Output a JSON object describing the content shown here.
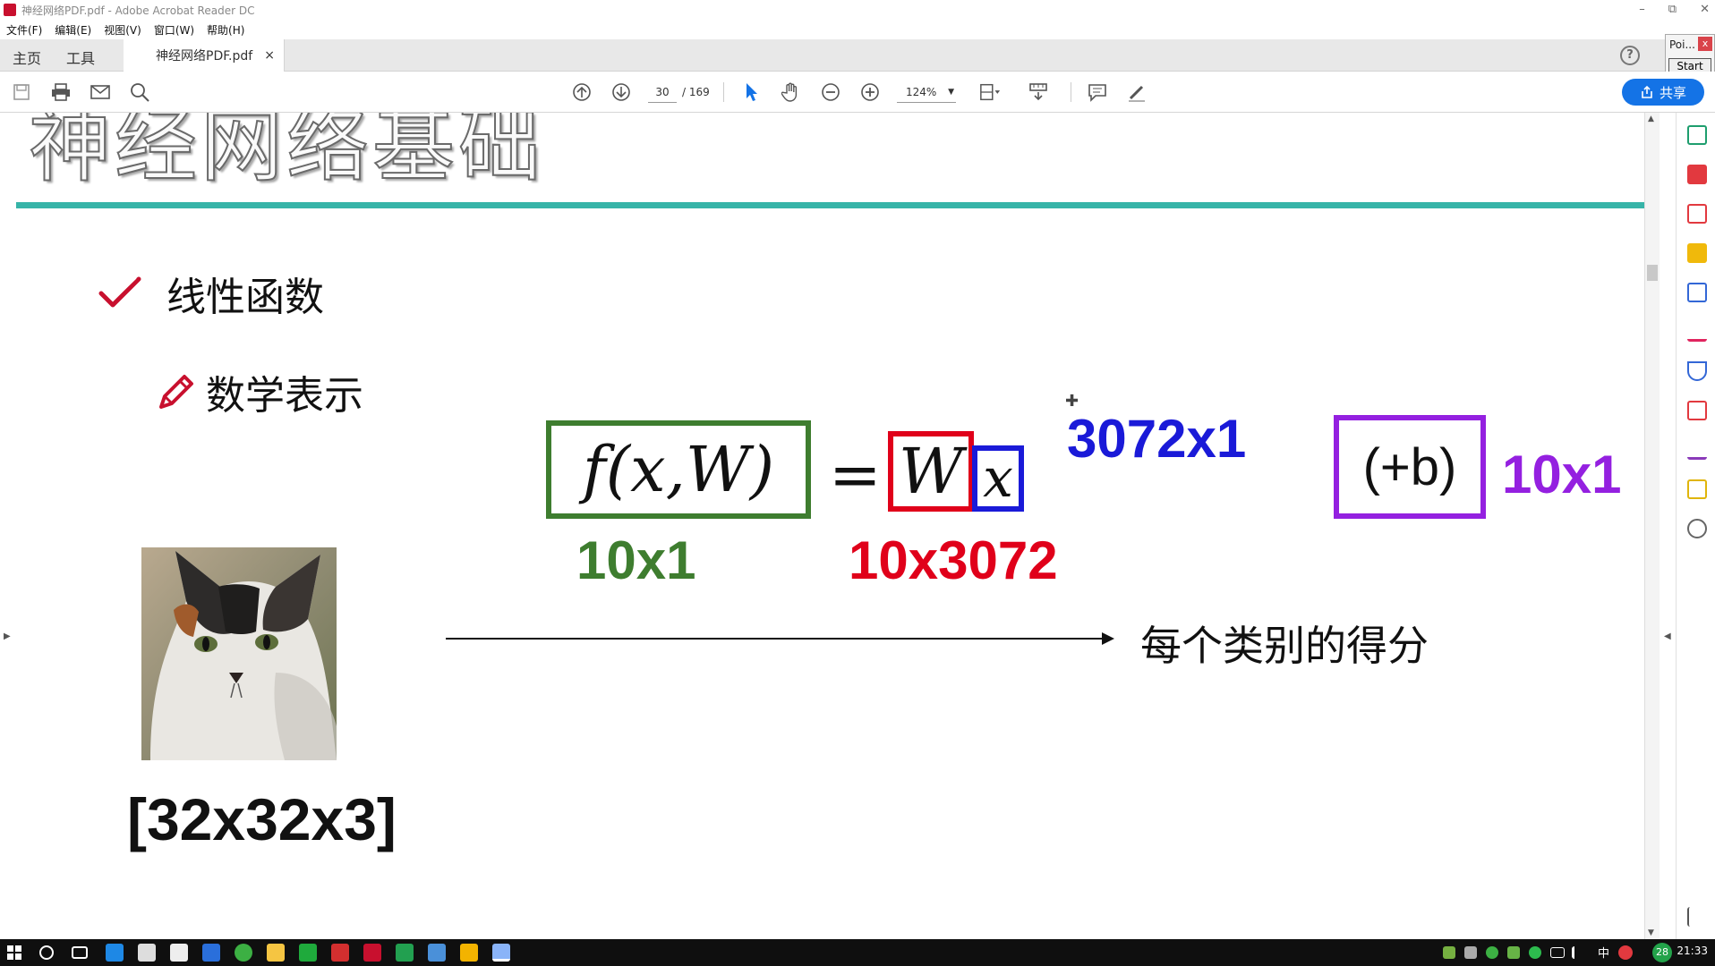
{
  "window": {
    "title": "神经网络PDF.pdf - Adobe Acrobat Reader DC"
  },
  "menu": [
    "文件(F)",
    "编辑(E)",
    "视图(V)",
    "窗口(W)",
    "帮助(H)"
  ],
  "topnav": {
    "home": "主页",
    "tools": "工具"
  },
  "tab": {
    "label": "神经网络PDF.pdf",
    "close": "×"
  },
  "help_label": "?",
  "poi_panel": {
    "title": "Poi...",
    "close": "x",
    "start": "Start"
  },
  "toolbar": {
    "page_current": "30",
    "page_total": "/ 169",
    "zoom": "124%",
    "share_label": "共享"
  },
  "slide": {
    "title": "神经网络基础",
    "bullet1": "线性函数",
    "bullet2": "数学表示",
    "formula_lhs": "f(x,W)",
    "equals": "=",
    "w_symbol": "W",
    "x_symbol": "x",
    "bias": "(+b)",
    "dim_output": "10x1",
    "dim_weights": "10x3072",
    "dim_input": "3072x1",
    "dim_bias": "10x1",
    "scores_label": "每个类别的得分",
    "image_shape": "[32x32x3]"
  },
  "taskbar": {
    "ime": "中",
    "badge": "28",
    "clock": "21:33"
  },
  "colors": {
    "accent_teal": "#36b4a8",
    "green": "#3e7d2f",
    "red": "#e0001a",
    "blue": "#1a1ad8",
    "purple": "#9420e0",
    "share_blue": "#1473e6"
  }
}
